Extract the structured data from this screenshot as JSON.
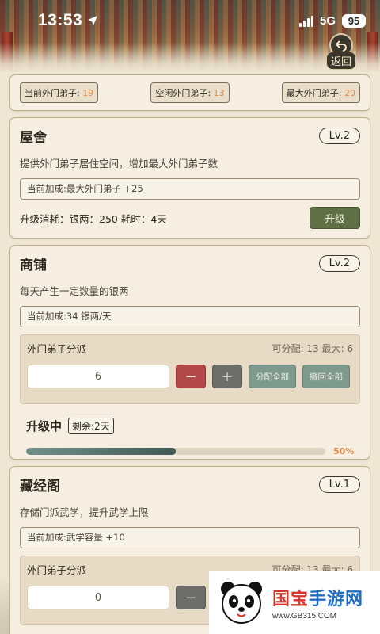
{
  "status_bar": {
    "time": "13:53",
    "network": "5G",
    "battery": "95"
  },
  "header": {
    "back_label": "返回"
  },
  "stats": {
    "current_label": "当前外门弟子:",
    "current_value": "19",
    "idle_label": "空闲外门弟子:",
    "idle_value": "13",
    "max_label": "最大外门弟子:",
    "max_value": "20"
  },
  "buildings": [
    {
      "name": "屋舍",
      "level": "Lv.2",
      "desc": "提供外门弟子居住空间，增加最大外门弟子数",
      "bonus": "当前加成:最大外门弟子 +25",
      "cost": "升级消耗：银两：250  耗时：4天",
      "upgrade_label": "升级"
    },
    {
      "name": "商铺",
      "level": "Lv.2",
      "desc": "每天产生一定数量的银两",
      "bonus": "当前加成:34 银两/天",
      "assign": {
        "title": "外门弟子分派",
        "info": "可分配: 13  最大: 6",
        "value": "6",
        "minus": "−",
        "plus": "+",
        "assign_all": "分配全部",
        "revoke_all": "撤回全部"
      },
      "progress": {
        "title": "升级中",
        "remaining": "剩余:2天",
        "percent_text": "50%",
        "fraction": 0.5
      }
    },
    {
      "name": "藏经阁",
      "level": "Lv.1",
      "desc": "存储门派武学，提升武学上限",
      "bonus": "当前加成:武学容量 +10",
      "assign": {
        "title": "外门弟子分派",
        "info": "可分配: 13  最大: 6",
        "value": "0",
        "minus": "−"
      }
    }
  ],
  "watermark": {
    "brand_a": "国宝",
    "brand_b": "手游网",
    "url": "www.GB315.COM"
  },
  "colors": {
    "accent_orange": "#e08a4a",
    "upgrade_green": "#5f7044",
    "minus_red": "#b24848",
    "action_teal": "#7e9a8f"
  }
}
